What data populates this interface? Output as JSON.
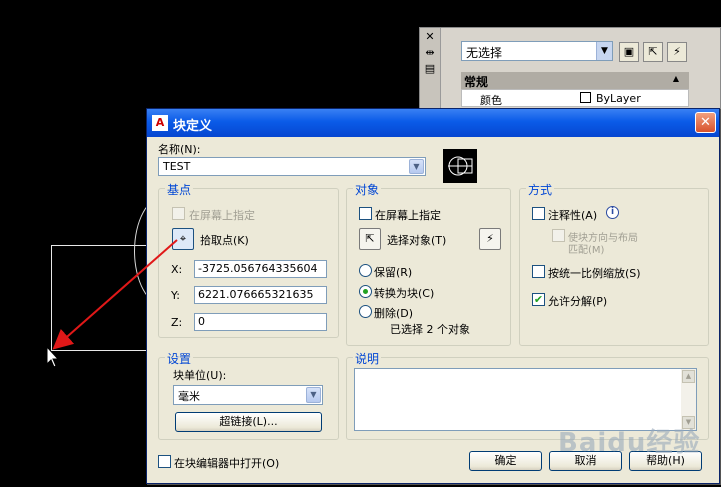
{
  "palette": {
    "close_glyph": "✕",
    "selection": "无选择",
    "category": "常规",
    "row_label": "颜色",
    "row_value": "ByLayer"
  },
  "dialog": {
    "title": "块定义",
    "name_label": "名称(N):",
    "name_value": "TEST",
    "base": {
      "title": "基点",
      "specify_on_screen": "在屏幕上指定",
      "pick_point": "拾取点(K)",
      "x_label": "X:",
      "x_value": "-3725.056764335604",
      "y_label": "Y:",
      "y_value": "6221.076665321635",
      "z_label": "Z:",
      "z_value": "0"
    },
    "objects": {
      "title": "对象",
      "specify_on_screen": "在屏幕上指定",
      "select_objects": "选择对象(T)",
      "retain": "保留(R)",
      "convert_to_block": "转换为块(C)",
      "delete": "删除(D)",
      "selected_count": "已选择 2 个对象"
    },
    "behavior": {
      "title": "方式",
      "annotative": "注释性(A)",
      "match_orientation_1": "使块方向与布局",
      "match_orientation_2": "匹配(M)",
      "scale_uniformly": "按统一比例缩放(S)",
      "allow_exploding": "允许分解(P)"
    },
    "settings": {
      "title": "设置",
      "block_unit_label": "块单位(U):",
      "block_unit_value": "毫米",
      "hyperlink": "超链接(L)..."
    },
    "description": {
      "title": "说明"
    },
    "open_in_editor": "在块编辑器中打开(O)",
    "ok": "确定",
    "cancel": "取消",
    "help": "帮助(H)"
  },
  "watermark": "Baidu经验",
  "colors": {
    "title_blue": "#0a5be8",
    "group_title": "#0046d5",
    "annotation_arrow": "#e01818"
  }
}
